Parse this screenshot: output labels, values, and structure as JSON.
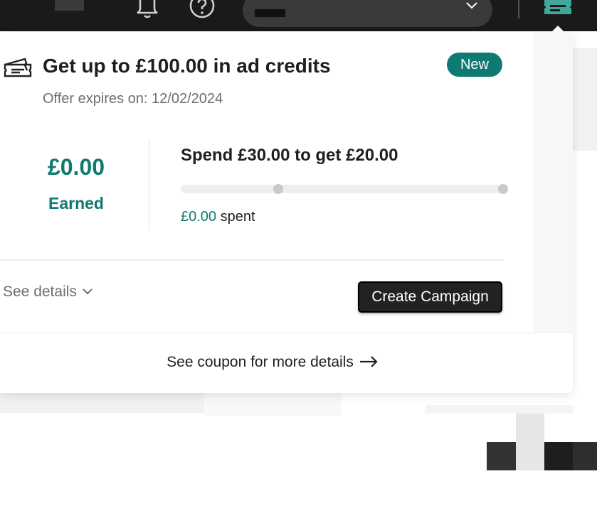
{
  "header": {
    "icons": [
      "notifications-bell-icon",
      "help-icon",
      "chevron-down-icon",
      "coupon-icon"
    ]
  },
  "offer": {
    "icon": "coupon-tickets-icon",
    "title": "Get up to £100.00 in ad credits",
    "badge": "New",
    "expires": "Offer expires on: 12/02/2024",
    "earned_amount": "£0.00",
    "earned_label": "Earned",
    "spend_heading": "Spend £30.00 to get £20.00",
    "progress": {
      "fraction": 0.0,
      "milestones": [
        0.3,
        1.0
      ]
    },
    "spent_amount": "£0.00",
    "spent_label": " spent",
    "see_details": "See details",
    "create_button": "Create Campaign",
    "footer_link": "See coupon for more details"
  },
  "colors": {
    "accent": "#0f7a72",
    "button": "#222222",
    "nav": "#1a1a1a"
  }
}
